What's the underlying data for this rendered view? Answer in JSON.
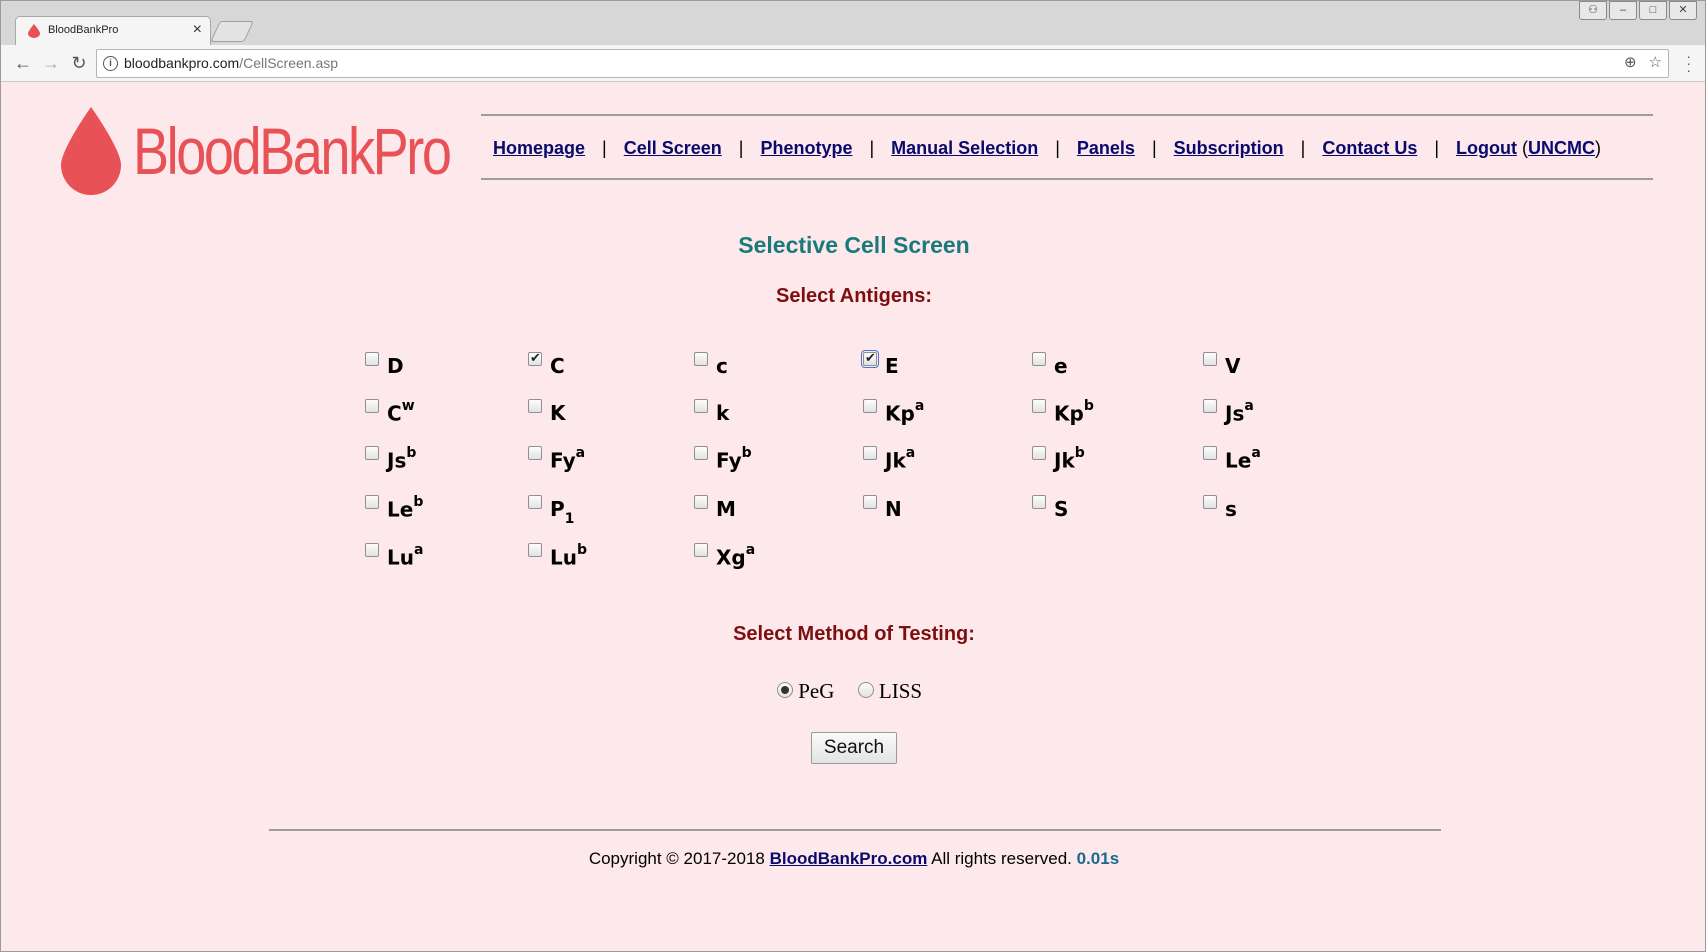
{
  "browser": {
    "tab_title": "BloodBankPro",
    "tab_close": "×",
    "url_host": "bloodbankpro.com",
    "url_path": "/CellScreen.asp",
    "win_buttons": [
      "⚇",
      "–",
      "□",
      "✕"
    ]
  },
  "logo": {
    "text": "BloodBankPro",
    "color": "#e85156"
  },
  "nav": {
    "links": [
      "Homepage",
      "Cell Screen",
      "Phenotype",
      "Manual Selection",
      "Panels",
      "Subscription",
      "Contact Us",
      "Logout"
    ],
    "separator": "|",
    "user": "UNCMC",
    "paren_open": "(",
    "paren_close": ")"
  },
  "main": {
    "title": "Selective Cell Screen",
    "antigens_heading": "Select Antigens:",
    "method_heading": "Select Method of Testing:",
    "methods": [
      {
        "label": "PeG",
        "selected": true
      },
      {
        "label": "LISS",
        "selected": false
      }
    ],
    "search_label": "Search"
  },
  "antigens": [
    {
      "base": "D",
      "sup": "",
      "sub": "",
      "checked": false
    },
    {
      "base": "C",
      "sup": "",
      "sub": "",
      "checked": true
    },
    {
      "base": "c",
      "sup": "",
      "sub": "",
      "checked": false
    },
    {
      "base": "E",
      "sup": "",
      "sub": "",
      "checked": true,
      "focused": true
    },
    {
      "base": "e",
      "sup": "",
      "sub": "",
      "checked": false
    },
    {
      "base": "V",
      "sup": "",
      "sub": "",
      "checked": false
    },
    {
      "base": "C",
      "sup": "w",
      "sub": "",
      "checked": false
    },
    {
      "base": "K",
      "sup": "",
      "sub": "",
      "checked": false
    },
    {
      "base": "k",
      "sup": "",
      "sub": "",
      "checked": false
    },
    {
      "base": "Kp",
      "sup": "a",
      "sub": "",
      "checked": false
    },
    {
      "base": "Kp",
      "sup": "b",
      "sub": "",
      "checked": false
    },
    {
      "base": "Js",
      "sup": "a",
      "sub": "",
      "checked": false
    },
    {
      "base": "Js",
      "sup": "b",
      "sub": "",
      "checked": false
    },
    {
      "base": "Fy",
      "sup": "a",
      "sub": "",
      "checked": false
    },
    {
      "base": "Fy",
      "sup": "b",
      "sub": "",
      "checked": false
    },
    {
      "base": "Jk",
      "sup": "a",
      "sub": "",
      "checked": false
    },
    {
      "base": "Jk",
      "sup": "b",
      "sub": "",
      "checked": false
    },
    {
      "base": "Le",
      "sup": "a",
      "sub": "",
      "checked": false
    },
    {
      "base": "Le",
      "sup": "b",
      "sub": "",
      "checked": false
    },
    {
      "base": "P",
      "sup": "",
      "sub": "1",
      "checked": false
    },
    {
      "base": "M",
      "sup": "",
      "sub": "",
      "checked": false
    },
    {
      "base": "N",
      "sup": "",
      "sub": "",
      "checked": false
    },
    {
      "base": "S",
      "sup": "",
      "sub": "",
      "checked": false
    },
    {
      "base": "s",
      "sup": "",
      "sub": "",
      "checked": false
    },
    {
      "base": "Lu",
      "sup": "a",
      "sub": "",
      "checked": false
    },
    {
      "base": "Lu",
      "sup": "b",
      "sub": "",
      "checked": false
    },
    {
      "base": "Xg",
      "sup": "a",
      "sub": "",
      "checked": false
    }
  ],
  "footer": {
    "copyright": "Copyright © 2017-2018 ",
    "site_link": "BloodBankPro.com",
    "rights": " All rights reserved. ",
    "time": "0.01s"
  },
  "colors": {
    "page_bg": "#fde8ec",
    "title": "#1a7a7a",
    "heading": "#7d0f0f",
    "link": "#0a0a6e"
  }
}
